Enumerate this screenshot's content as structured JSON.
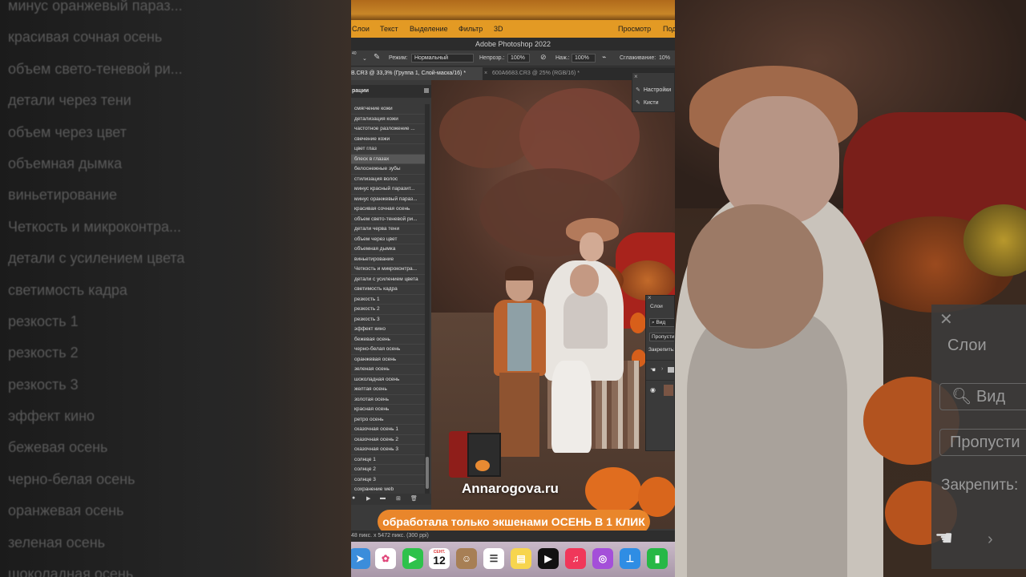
{
  "left_backdrop": {
    "items": [
      "минус оранжевый параз...",
      "красивая сочная осень",
      "объем свето-теневой ри...",
      "детали через тени",
      "объем через цвет",
      "объемная дымка",
      "виньетирование",
      "Четкость и микроконтра...",
      "детали с усилением цвета",
      "светимость кадра",
      "резкость 1",
      "резкость 2",
      "резкость 3",
      "эффект кино",
      "бежевая осень",
      "черно-белая осень",
      "оранжевая осень",
      "зеленая осень",
      "шоколадная осень"
    ]
  },
  "right_backdrop": {
    "close": "✕",
    "title": "Слои",
    "search": "Вид",
    "skip": "Пропусти",
    "lock": "Закрепить:",
    "arrow": "›"
  },
  "menubar": {
    "items": [
      "Слои",
      "Текст",
      "Выделение",
      "Фильтр",
      "3D",
      "Просмотр",
      "Под"
    ]
  },
  "window_title": "Adobe Photoshop 2022",
  "options_bar": {
    "brush_size": "40",
    "mode_label": "Режим:",
    "mode_value": "Нормальный",
    "opacity_label": "Непрозр.:",
    "opacity_value": "100%",
    "pressure_label": "Наж.:",
    "pressure_value": "100%",
    "smoothing_label": "Сглаживание:",
    "smoothing_value": "10%"
  },
  "tabs": {
    "active": "B.CR3 @ 33,3% (Группа 1, Слой-маска/16) *",
    "inactive_close": "×",
    "inactive": "600A6683.CR3 @ 25% (RGB/16) *"
  },
  "actions_panel": {
    "title": "рации",
    "selected_index": 5,
    "items": [
      "смягчение кожи",
      "детализация кожи",
      "частотное разложение ...",
      "свечение кожи",
      "цвет глаз",
      "блеск в глазах",
      "белоснежные зубы",
      "стилизация волос",
      "минус красный паразит...",
      "минус оранжевый параз...",
      "красивая сочная осень",
      "объем свето-теневой ри...",
      "детали черва тени",
      "объем через цвет",
      "объемная дымка",
      "виньетирование",
      "Четкость и микроконтра...",
      "детали с усилением цвета",
      "светимость кадра",
      "резкость 1",
      "резкость 2",
      "резкость 3",
      "эффект кино",
      "бежевая осень",
      "черно-белая осень",
      "оранжевая осень",
      "зеленая осень",
      "шоколадная осень",
      "желтая осень",
      "золотая осень",
      "красная осень",
      "ретро осень",
      "сказочная осень 1",
      "сказочная осень 2",
      "сказочная осень 3",
      "солнце 1",
      "солнце 2",
      "солнце 3",
      "сохранение web"
    ]
  },
  "mini_panel": {
    "close": "×",
    "row1": "Настройки",
    "row2": "Кисти"
  },
  "layers_panel": {
    "close": "×",
    "title": "Слои",
    "search": "Вид",
    "skip": "Пропусти",
    "lock": "Закрепить:"
  },
  "watermark": "Annarogova.ru",
  "caption": "обработала только экшенами ОСЕНЬ В 1 КЛИК",
  "status_bar": "48 пикс. x 5472 пикс. (300 ppi)",
  "dock": {
    "calendar_month": "СЕНТ.",
    "calendar_day": "12",
    "icons": [
      "maps-icon",
      "photos-icon",
      "facetime-icon",
      "calendar-icon",
      "contacts-icon",
      "reminders-icon",
      "notes-icon",
      "appletv-icon",
      "music-icon",
      "podcasts-icon",
      "keynote-icon",
      "numbers-icon"
    ]
  },
  "colors": {
    "menubar_accent": "#e39a24",
    "caption_bg": "#e9862b",
    "panel_bg": "#3a3a3a"
  }
}
